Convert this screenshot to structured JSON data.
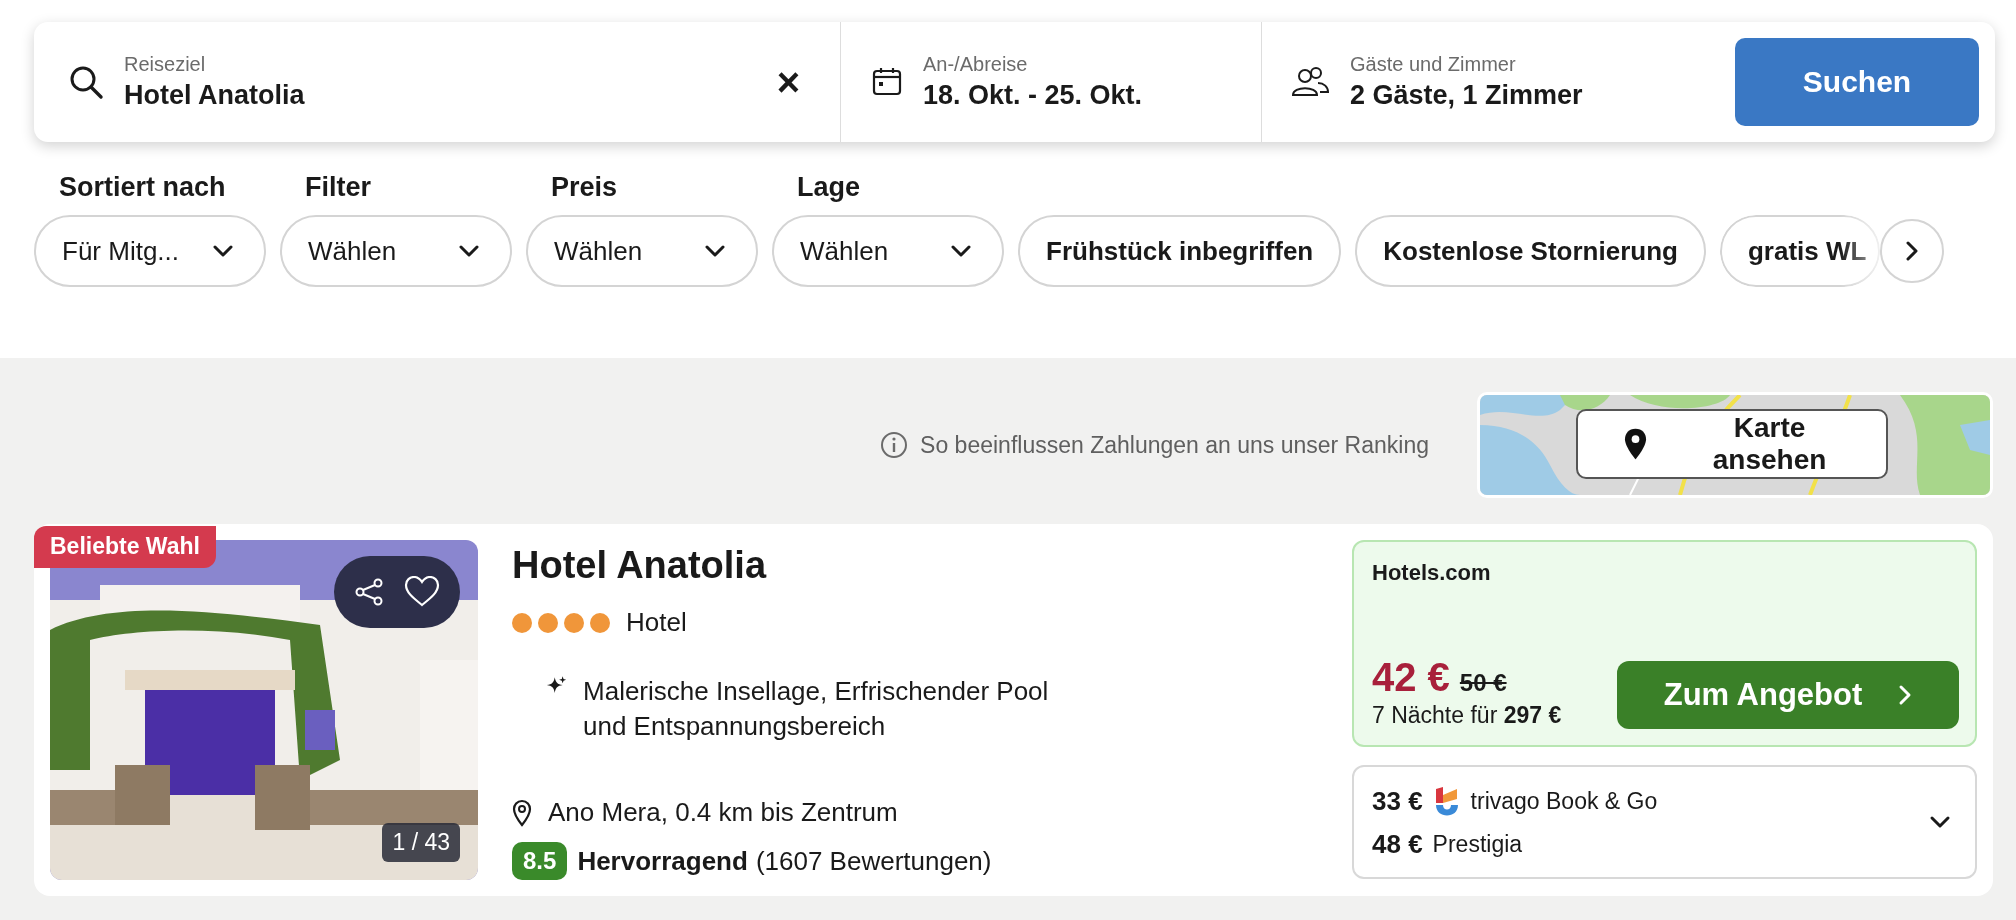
{
  "search": {
    "destination": {
      "label": "Reiseziel",
      "value": "Hotel Anatolia",
      "clear": "×"
    },
    "dates": {
      "label": "An-/Abreise",
      "value": "18. Okt. - 25. Okt."
    },
    "guests": {
      "label": "Gäste und Zimmer",
      "value": "2 Gäste, 1 Zimmer"
    },
    "button": "Suchen"
  },
  "filters": [
    {
      "label": "Sortiert nach",
      "value": "Für Mitg..."
    },
    {
      "label": "Filter",
      "value": "Wählen"
    },
    {
      "label": "Preis",
      "value": "Wählen"
    },
    {
      "label": "Lage",
      "value": "Wählen"
    }
  ],
  "chips": [
    {
      "label": "Frühstück inbegriffen",
      "selected": false
    },
    {
      "label": "Kostenlose Stornierung",
      "selected": false
    },
    {
      "label": "gratis WL",
      "selected": false
    }
  ],
  "ranking_info": "So beeinflussen Zahlungen an uns unser Ranking",
  "map_button": "Karte ansehen",
  "hotel": {
    "badge": "Beliebte Wahl",
    "photo_counter": "1 / 43",
    "name": "Hotel Anatolia",
    "stars": 4,
    "type": "Hotel",
    "highlight": "Malerische Insellage, Erfrischender Pool und Entspannungsbereich",
    "location": "Ano Mera, 0.4 km bis Zentrum",
    "score": "8.5",
    "score_label": "Hervorragend",
    "reviews": "(1607 Bewertungen)",
    "offer": {
      "provider": "Hotels.com",
      "price": "42 €",
      "old_price": "50 €",
      "total": "7 Nächte für **297 €**",
      "button": "Zum Angebot"
    },
    "alternatives": [
      {
        "kind": "logo",
        "price": "33 €",
        "provider": "trivago Book & Go"
      },
      {
        "kind": "plain",
        "price": "48 €",
        "provider": "Prestigia"
      }
    ]
  }
}
